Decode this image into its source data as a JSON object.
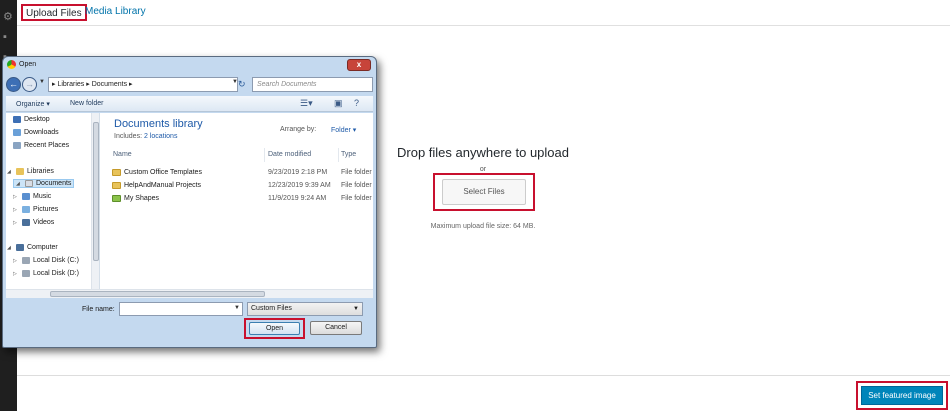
{
  "router": {
    "tabs": [
      {
        "label": "Upload Files"
      },
      {
        "label": "Media Library"
      }
    ]
  },
  "uploader": {
    "drop_title": "Drop files anywhere to upload",
    "or_text": "or",
    "select_files_label": "Select Files",
    "max_size": "Maximum upload file size: 64 MB."
  },
  "toolbar": {
    "set_featured_label": "Set featured image"
  },
  "dialog": {
    "title": "Open",
    "close_glyph": "x",
    "address": "▸ Libraries ▸ Documents ▸",
    "search_placeholder": "Search Documents",
    "organize_label": "Organize ▾",
    "new_folder_label": "New folder",
    "nav": {
      "favorites": [
        {
          "label": "Desktop"
        },
        {
          "label": "Downloads"
        },
        {
          "label": "Recent Places"
        }
      ],
      "libraries_label": "Libraries",
      "libraries": [
        {
          "label": "Documents"
        },
        {
          "label": "Music"
        },
        {
          "label": "Pictures"
        },
        {
          "label": "Videos"
        }
      ],
      "computer_label": "Computer",
      "drives": [
        {
          "label": "Local Disk (C:)"
        },
        {
          "label": "Local Disk (D:)"
        }
      ]
    },
    "library": {
      "title": "Documents library",
      "includes_label": "Includes:",
      "includes_link": "2 locations",
      "arrange_label": "Arrange by:",
      "arrange_value": "Folder ▾"
    },
    "columns": {
      "name": "Name",
      "date": "Date modified",
      "type": "Type"
    },
    "files": [
      {
        "name": "Custom Office Templates",
        "date": "9/23/2019 2:18 PM",
        "type": "File folder"
      },
      {
        "name": "HelpAndManual Projects",
        "date": "12/23/2019 9:39 AM",
        "type": "File folder"
      },
      {
        "name": "My Shapes",
        "date": "11/9/2019 9:24 AM",
        "type": "File folder"
      }
    ],
    "file_name_label": "File name:",
    "file_name_value": "",
    "filter_value": "Custom Files",
    "open_label": "Open",
    "cancel_label": "Cancel"
  },
  "colors": {
    "highlight_red": "#c8102e",
    "wp_blue": "#0085ba",
    "link_blue": "#0073aa"
  }
}
